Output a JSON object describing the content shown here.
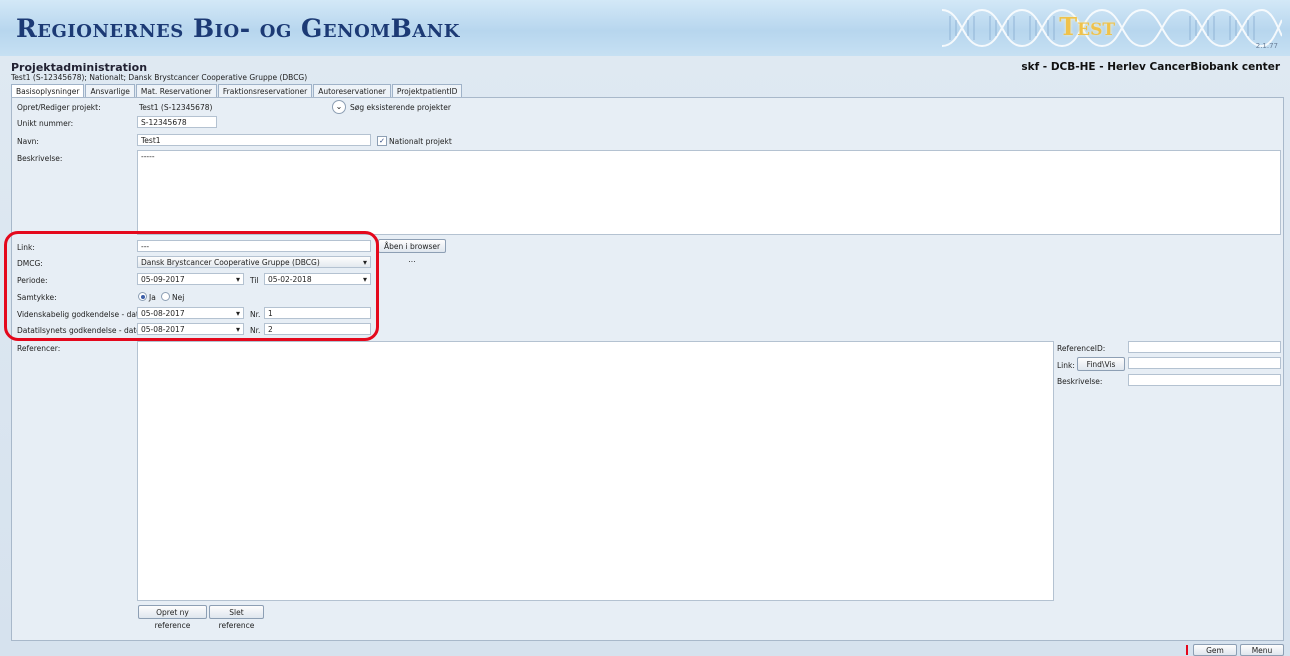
{
  "banner": {
    "title": "Regionernes Bio- og GenomBank",
    "test_label": "Test",
    "build": "2.1.77"
  },
  "header": {
    "page_title": "Projektadministration",
    "subtitle": "Test1 (S-12345678); Nationalt; Dansk Brystcancer Cooperative Gruppe (DBCG)",
    "user_info": "skf - DCB-HE - Herlev CancerBiobank center"
  },
  "tabs": [
    {
      "label": "Basisoplysninger",
      "active": true
    },
    {
      "label": "Ansvarlige"
    },
    {
      "label": "Mat. Reservationer"
    },
    {
      "label": "Fraktionsreservationer"
    },
    {
      "label": "Autoreservationer"
    },
    {
      "label": "ProjektpatientID"
    }
  ],
  "form": {
    "project_label": "Opret/Rediger projekt:",
    "project_value": "Test1 (S-12345678)",
    "search_existing_label": "Søg eksisterende projekter",
    "unique_label": "Unikt nummer:",
    "unique_value": "S-12345678",
    "name_label": "Navn:",
    "name_value": "Test1",
    "national_label": "Nationalt projekt",
    "national_checked": "✓",
    "description_label": "Beskrivelse:",
    "description_value": "-----",
    "link_label": "Link:",
    "link_value": "---",
    "open_browser_label": "Åben i browser ...",
    "dmcg_label": "DMCG:",
    "dmcg_value": "Dansk Brystcancer Cooperative Gruppe (DBCG)",
    "period_label": "Periode:",
    "period_from": "05-09-2017",
    "period_to_label": "Til",
    "period_to": "05-02-2018",
    "consent_label": "Samtykke:",
    "consent_yes": "Ja",
    "consent_no": "Nej",
    "consent_selected": "Ja",
    "sci_approval_label": "Videnskabelig godkendelse - dato:",
    "sci_approval_date": "05-08-2017",
    "sci_nr_label": "Nr.",
    "sci_nr_value": "1",
    "dt_approval_label": "Datatilsynets godkendelse - dato:",
    "dt_approval_date": "05-08-2017",
    "dt_nr_label": "Nr.",
    "dt_nr_value": "2",
    "references_label": "Referencer:",
    "new_reference_label": "Opret ny reference",
    "delete_reference_label": "Slet reference",
    "reference_id_label": "ReferenceID:",
    "ref_link_label": "Link:",
    "find_view_label": "Find\\Vis",
    "ref_description_label": "Beskrivelse:"
  },
  "footer": {
    "save_label": "Gem",
    "menu_label": "Menu"
  },
  "colors": {
    "highlight": "#e4081c",
    "banner_title": "#1c3a75",
    "test_word": "#f0c24a"
  }
}
